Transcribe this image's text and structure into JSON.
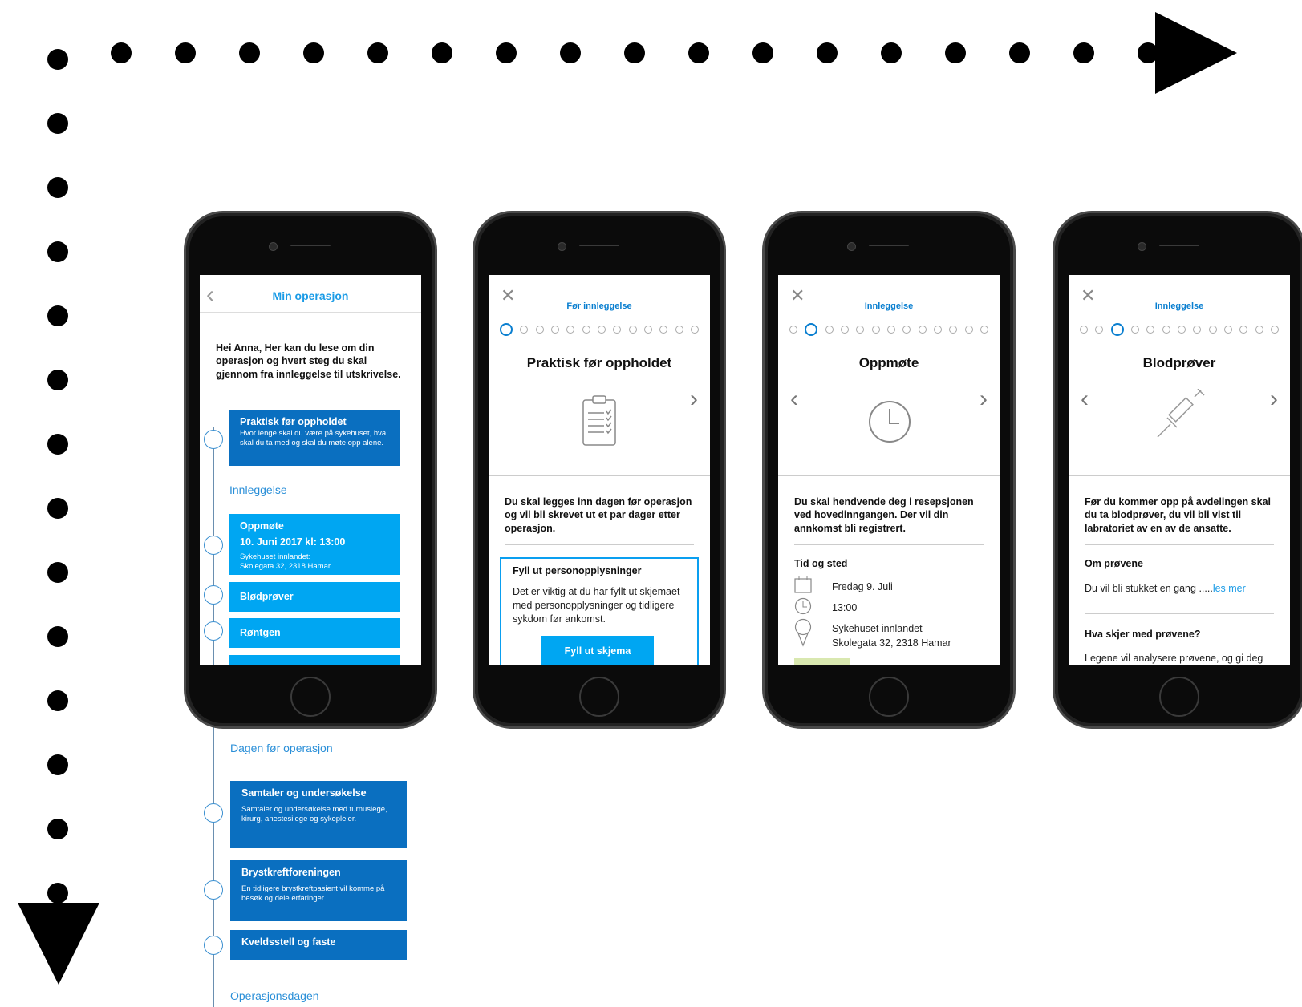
{
  "phone1": {
    "header_title": "Min operasjon",
    "back_icon": "chevron-left-icon",
    "greeting": "Hei Anna, Her kan du lese om din operasjon og hvert steg du skal gjennom fra innleggelse til utskrivelse.",
    "items": [
      {
        "title": "Praktisk før oppholdet",
        "desc": "Hvor lenge skal du være på sykehuset, hva skal du ta med og skal du møte opp alene.",
        "icon": "clipboard-icon"
      },
      {
        "title": "Oppmøte",
        "date": "10. Juni 2017  kl: 13:00",
        "desc": "Sykehuset innlandet:\nSkolegata 32, 2318 Hamar",
        "icon": "clock-icon"
      },
      {
        "title": "Blødprøver",
        "icon": "syringe-icon"
      },
      {
        "title": "Røntgen",
        "icon": "xray-icon"
      }
    ],
    "section_innleggelse": "Innleggelse"
  },
  "timeline_below": {
    "section_dagen": "Dagen før operasjon",
    "items": [
      {
        "title": "Samtaler og undersøkelse",
        "desc": "Samtaler og undersøkelse med turnuslege, kirurg, anestesilege og sykepleier.",
        "icon": "chat-icon"
      },
      {
        "title": "Brystkreftforeningen",
        "desc": "En tidligere brystkreftpasient vil komme på besøk og dele erfaringer",
        "icon": "people-icon"
      },
      {
        "title": "Kveldsstell og faste",
        "icon": "syringe-icon"
      }
    ],
    "section_operasjonsdagen": "Operasjonsdagen"
  },
  "phone2": {
    "subtitle": "Før innleggelse",
    "title": "Praktisk før oppholdet",
    "active_step": 0,
    "steps": 13,
    "body": "Du skal legges inn dagen før operasjon og vil bli skrevet ut et par dager etter operasjon.",
    "card_title": "Fyll ut personopplysninger",
    "card_text": "Det er viktig at du har fyllt ut skjemaet med personopplysninger og tidligere sykdom før ankomst.",
    "button_label": "Fyll ut skjema",
    "hero_icon": "clipboard-icon"
  },
  "phone3": {
    "subtitle": "Innleggelse",
    "title": "Oppmøte",
    "active_step": 1,
    "steps": 13,
    "body": "Du skal hendvende deg i resepsjonen ved hovedinngangen. Der vil din annkomst bli registrert.",
    "section_title": "Tid og sted",
    "date": "Fredag 9. Juli",
    "time": "13:00",
    "place_line1": "Sykehuset innlandet",
    "place_line2": "Skolegata 32, 2318 Hamar",
    "hero_icon": "clock-icon"
  },
  "phone4": {
    "subtitle": "Innleggelse",
    "title": "Blodprøver",
    "active_step": 2,
    "steps": 13,
    "body": "Før du kommer opp på avdelingen skal du ta blodprøver, du vil bli vist til labratoriet av en av de ansatte.",
    "section1_title": "Om prøvene",
    "section1_text": "Du vil bli stukket en gang .....",
    "read_more": "les mer",
    "section2_title": "Hva skjer med prøvene?",
    "section2_text": "Legene vil analysere prøvene, og gi deg",
    "hero_icon": "syringe-icon"
  },
  "colors": {
    "accent": "#0a7fd0",
    "item_dark": "#0a6fc0",
    "item_light": "#00a6f2"
  }
}
